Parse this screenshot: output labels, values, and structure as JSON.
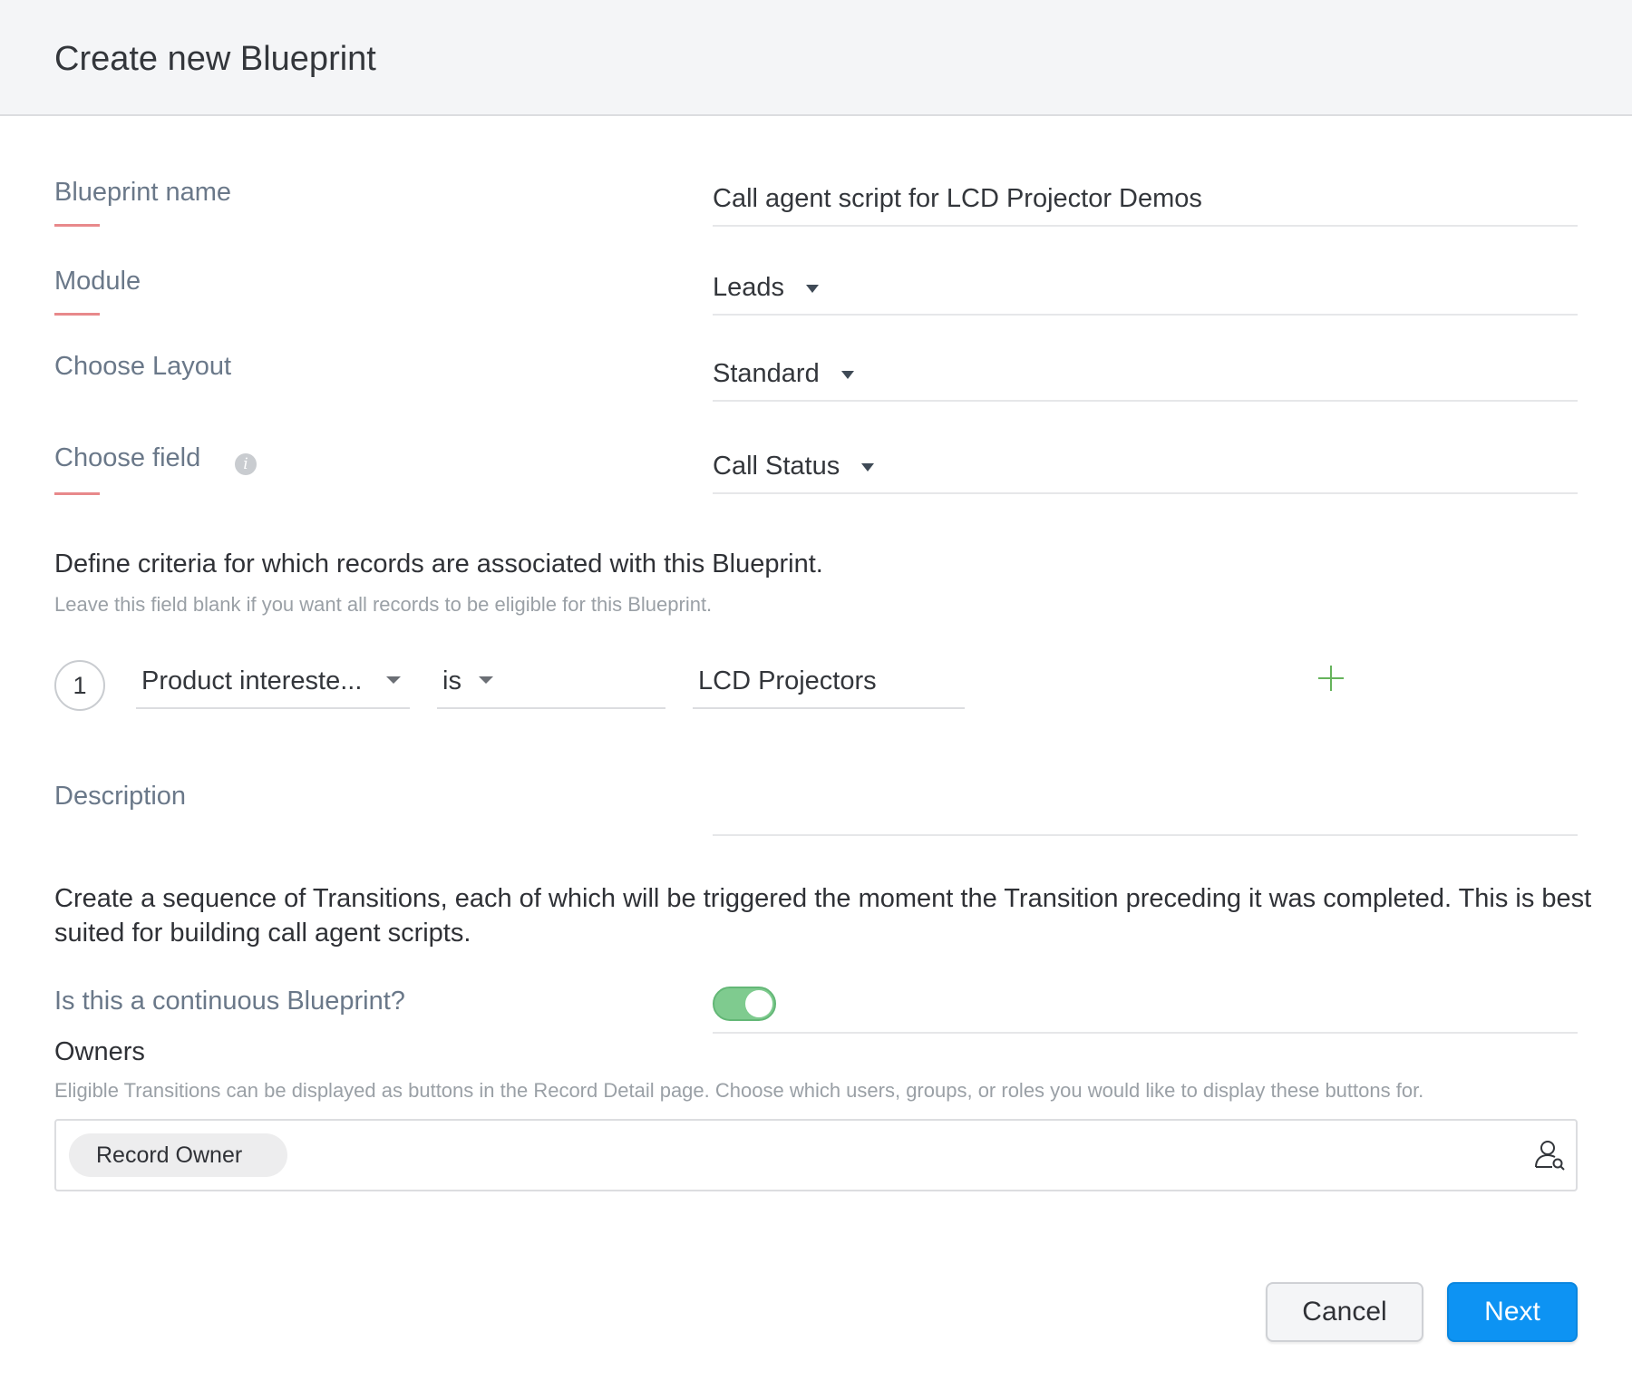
{
  "header": {
    "title": "Create new Blueprint"
  },
  "fields": {
    "blueprint_name": {
      "label": "Blueprint name",
      "value": "Call agent script for LCD Projector Demos"
    },
    "module": {
      "label": "Module",
      "value": "Leads"
    },
    "layout": {
      "label": "Choose Layout",
      "value": "Standard"
    },
    "field": {
      "label": "Choose field",
      "value": "Call Status"
    }
  },
  "criteria": {
    "heading": "Define criteria for which records are associated with this Blueprint.",
    "subtext": "Leave this field blank if you want all records to be eligible for this Blueprint.",
    "rows": [
      {
        "number": "1",
        "field": "Product intereste...",
        "operator": "is",
        "value": "LCD Projectors"
      }
    ]
  },
  "description": {
    "label": "Description",
    "value": ""
  },
  "continuous": {
    "paragraph": "Create a sequence of Transitions, each of which will be triggered the moment the Transition preceding it was completed. This is best suited for building call agent scripts.",
    "label": "Is this a continuous Blueprint?",
    "enabled": true
  },
  "owners": {
    "heading": "Owners",
    "subtext": "Eligible Transitions can be displayed as buttons in the Record Detail page. Choose which users, groups, or roles you would like to display these buttons for.",
    "chips": [
      "Record Owner"
    ]
  },
  "actions": {
    "cancel_label": "Cancel",
    "next_label": "Next"
  },
  "colors": {
    "accent": "#0d93f3",
    "toggle_on": "#7fcb8f",
    "mandatory": "#e8898b",
    "add_icon": "#66b35c"
  },
  "icons": {
    "info": "info-icon",
    "add": "plus-icon",
    "user_lookup": "user-search-icon",
    "dropdown": "caret-down-icon"
  }
}
